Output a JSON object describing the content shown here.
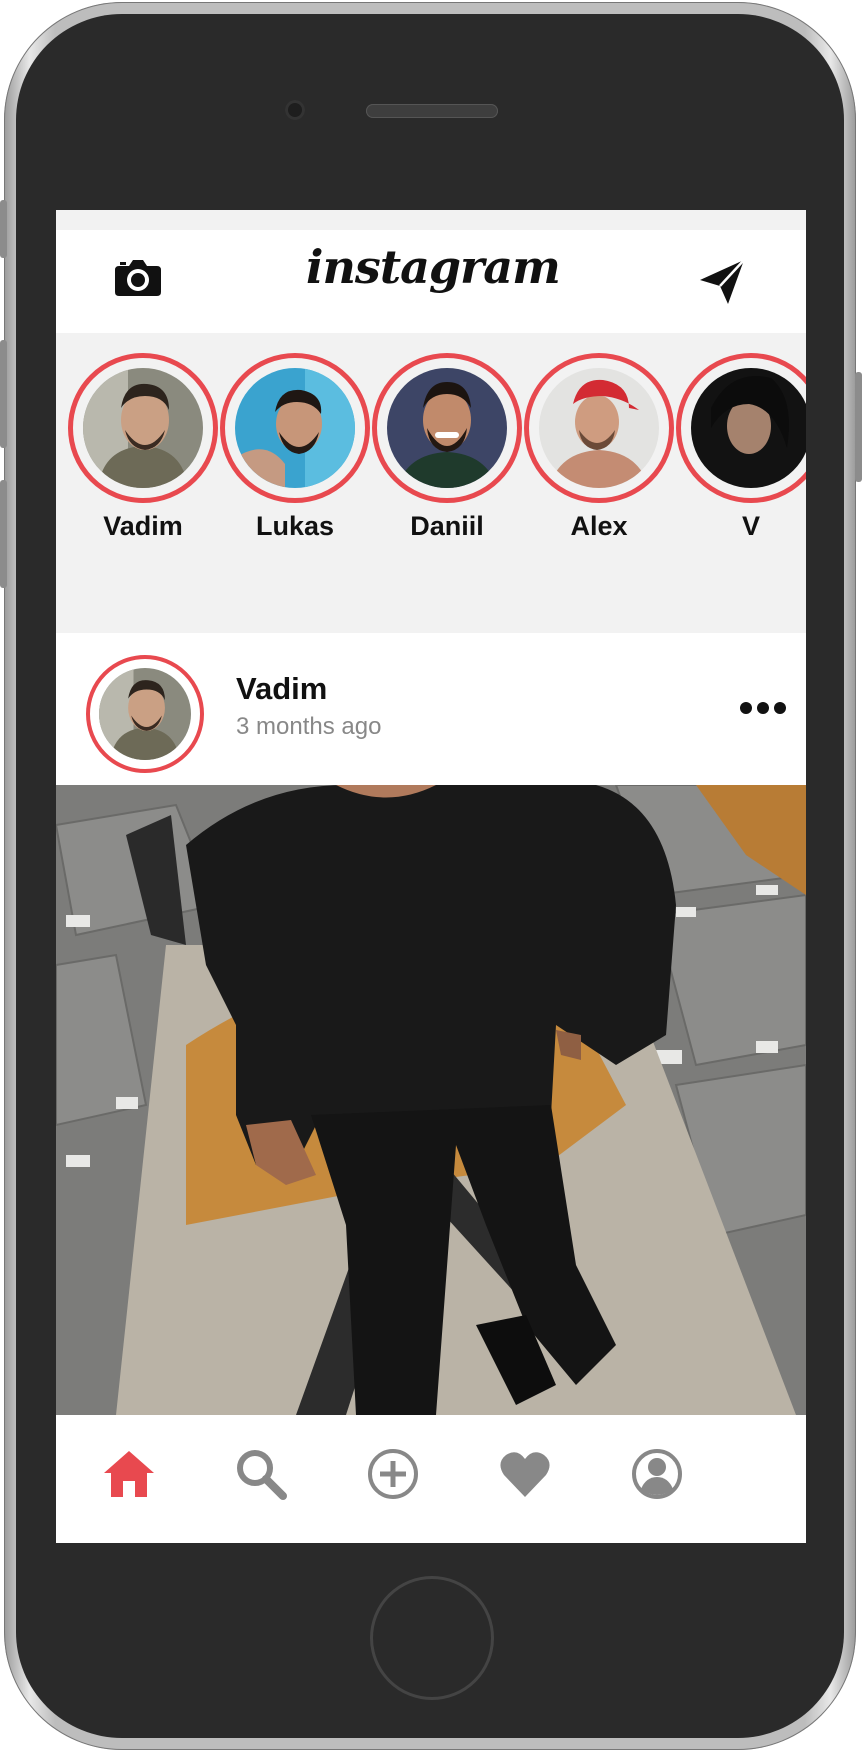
{
  "header": {
    "logo": "instagram",
    "camera_icon": "camera-icon",
    "send_icon": "send-icon"
  },
  "stories": [
    {
      "name": "Vadim"
    },
    {
      "name": "Lukas"
    },
    {
      "name": "Daniil"
    },
    {
      "name": "Alex"
    },
    {
      "name": "V"
    }
  ],
  "post": {
    "user": "Vadim",
    "time": "3 months ago",
    "more_icon": "more-icon"
  },
  "tabbar": {
    "items": [
      "home-icon",
      "search-icon",
      "add-icon",
      "heart-icon",
      "profile-icon"
    ],
    "active_color": "#e8494f",
    "inactive_color": "#888888"
  },
  "colors": {
    "accent": "#e8494f"
  }
}
